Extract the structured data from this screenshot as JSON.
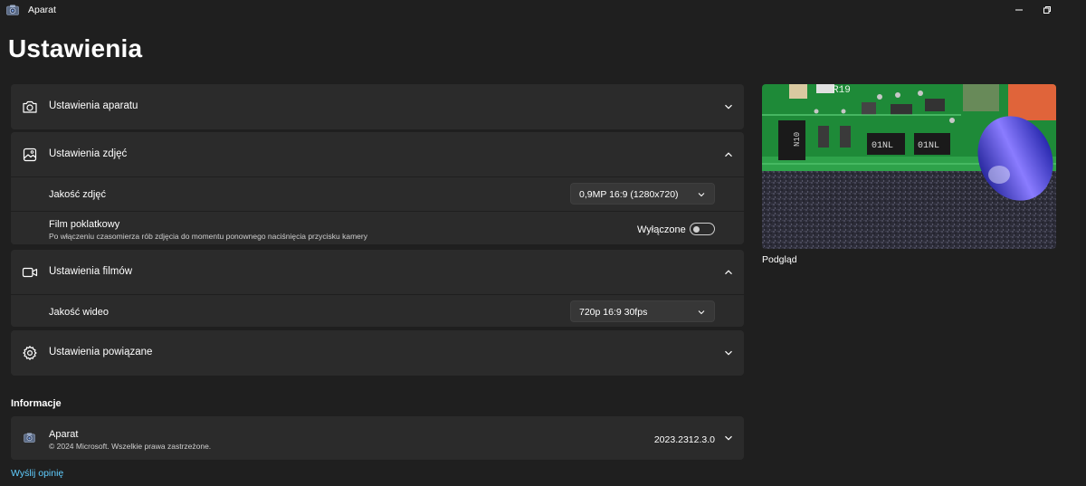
{
  "window": {
    "title": "Aparat",
    "icons": {
      "app": "camera-app-icon",
      "minimize": "minimize-icon",
      "maximize": "maximize-icon"
    }
  },
  "page": {
    "title": "Ustawienia"
  },
  "sections": {
    "camera": {
      "label": "Ustawienia aparatu",
      "icon": "camera-icon",
      "expanded": false
    },
    "photo": {
      "label": "Ustawienia zdjęć",
      "icon": "image-icon",
      "expanded": true,
      "quality": {
        "label": "Jakość zdjęć",
        "value": "0,9MP 16:9 (1280x720)"
      },
      "timelapse": {
        "label": "Film poklatkowy",
        "description": "Po włączeniu czasomierza rób zdjęcia do momentu ponownego naciśnięcia przycisku kamery",
        "state_label": "Wyłączone",
        "on": false
      }
    },
    "video": {
      "label": "Ustawienia filmów",
      "icon": "video-icon",
      "expanded": true,
      "quality": {
        "label": "Jakość wideo",
        "value": "720p 16:9 30fps"
      }
    },
    "related": {
      "label": "Ustawienia powiązane",
      "icon": "gear-icon",
      "expanded": false
    }
  },
  "info": {
    "heading": "Informacje",
    "app_name": "Aparat",
    "copyright": "© 2024 Microsoft. Wszelkie prawa zastrzeżone.",
    "version": "2023.2312.3.0"
  },
  "feedback": {
    "label": "Wyślij opinię"
  },
  "preview": {
    "caption": "Podgląd"
  },
  "colors": {
    "background": "#1f1f1f",
    "card": "#2b2b2b",
    "link": "#60cdff",
    "pcb_green": "#1f8a3a"
  }
}
